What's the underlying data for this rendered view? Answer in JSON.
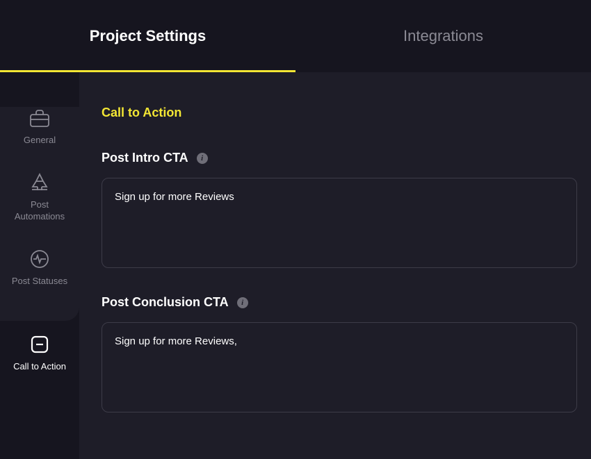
{
  "tabs": {
    "project_settings": "Project Settings",
    "integrations": "Integrations"
  },
  "sidebar": {
    "items": [
      {
        "label": "General"
      },
      {
        "label": "Post Automations"
      },
      {
        "label": "Post Statuses"
      },
      {
        "label": "Call to Action"
      }
    ]
  },
  "content": {
    "section_title": "Call to Action",
    "intro_label": "Post Intro CTA",
    "intro_value": "Sign up for more Reviews",
    "conclusion_label": "Post Conclusion CTA",
    "conclusion_value": "Sign up for more Reviews,"
  }
}
